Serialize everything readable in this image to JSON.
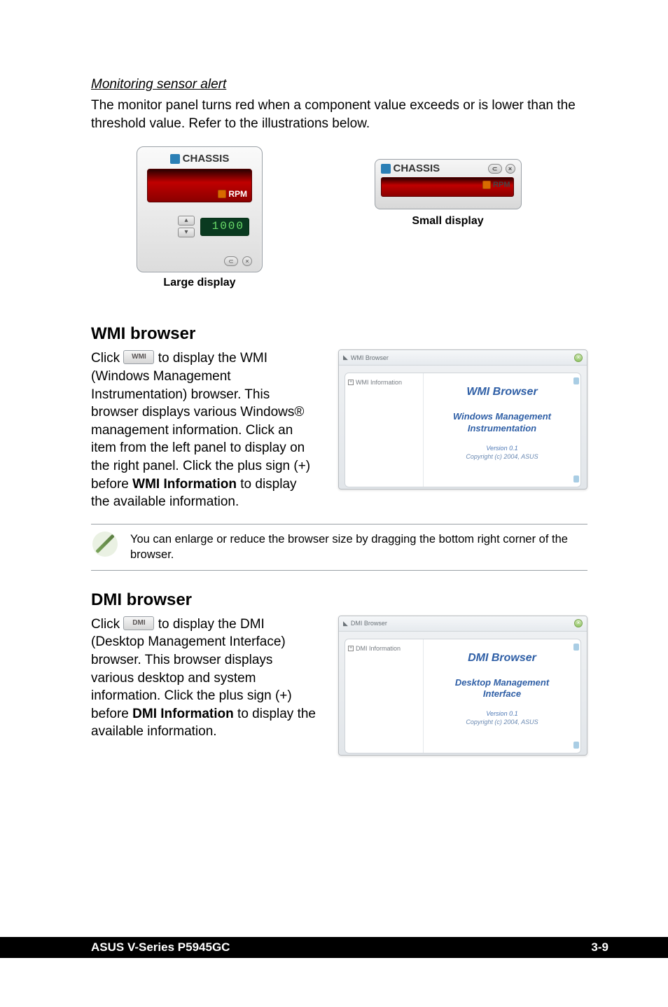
{
  "monitoring": {
    "heading": "Monitoring sensor alert",
    "body": "The monitor panel turns red when a component value exceeds or is lower than the threshold value. Refer to the illustrations below.",
    "chassis_label": "CHASSIS",
    "rpm_label": "RPM",
    "threshold_value": "1000",
    "large_caption": "Large display",
    "small_caption": "Small display"
  },
  "wmi": {
    "heading": "WMI browser",
    "btn_label": "WMI",
    "para_pre": "Click ",
    "para_post_1": " to display the WMI (Windows Management Instrumentation) browser. This browser displays various Windows® management information. Click an item from the left panel to display on the right panel. Click the plus sign (+) before ",
    "bold_term": "WMI Information",
    "para_post_2": " to display the available information.",
    "window_title": "WMI Browser",
    "tree_label": "WMI Information",
    "pane_title": "WMI  Browser",
    "pane_sub1": "Windows Management",
    "pane_sub2": "Instrumentation",
    "pane_ver": "Version 0.1",
    "pane_copy": "Copyright (c) 2004, ASUS"
  },
  "note": {
    "text": "You can enlarge or reduce the browser size by dragging the bottom right corner of the browser."
  },
  "dmi": {
    "heading": "DMI browser",
    "btn_label": "DMI",
    "para_pre": "Click ",
    "para_post_1": " to display the DMI (Desktop Management Interface) browser. This browser displays various desktop and system information. Click the plus sign (+) before ",
    "bold_term": "DMI Information",
    "para_post_2": " to display the available information.",
    "window_title": "DMI Browser",
    "tree_label": "DMI Information",
    "pane_title": "DMI  Browser",
    "pane_sub1": "Desktop Management",
    "pane_sub2": "Interface",
    "pane_ver": "Version 0.1",
    "pane_copy": "Copyright (c) 2004, ASUS"
  },
  "footer": {
    "left": "ASUS V-Series P5945GC",
    "right": "3-9"
  }
}
